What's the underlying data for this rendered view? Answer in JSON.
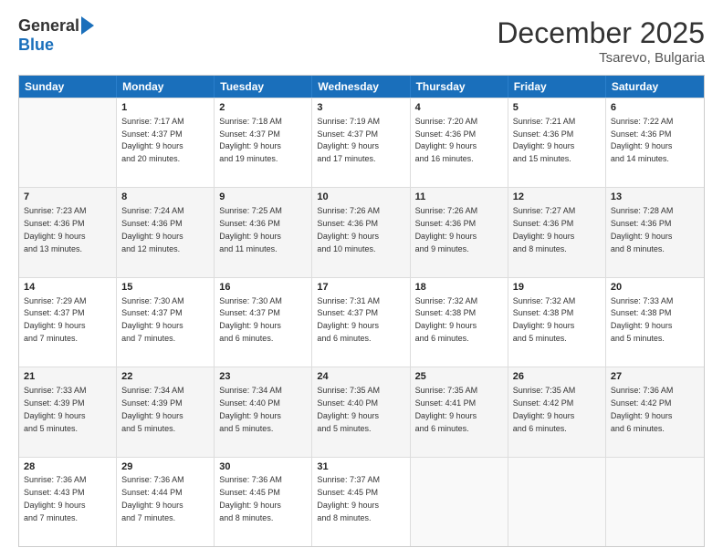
{
  "logo": {
    "general": "General",
    "blue": "Blue"
  },
  "title": "December 2025",
  "location": "Tsarevo, Bulgaria",
  "days": [
    "Sunday",
    "Monday",
    "Tuesday",
    "Wednesday",
    "Thursday",
    "Friday",
    "Saturday"
  ],
  "weeks": [
    [
      {
        "day": "",
        "info": ""
      },
      {
        "day": "1",
        "info": "Sunrise: 7:17 AM\nSunset: 4:37 PM\nDaylight: 9 hours\nand 20 minutes."
      },
      {
        "day": "2",
        "info": "Sunrise: 7:18 AM\nSunset: 4:37 PM\nDaylight: 9 hours\nand 19 minutes."
      },
      {
        "day": "3",
        "info": "Sunrise: 7:19 AM\nSunset: 4:37 PM\nDaylight: 9 hours\nand 17 minutes."
      },
      {
        "day": "4",
        "info": "Sunrise: 7:20 AM\nSunset: 4:36 PM\nDaylight: 9 hours\nand 16 minutes."
      },
      {
        "day": "5",
        "info": "Sunrise: 7:21 AM\nSunset: 4:36 PM\nDaylight: 9 hours\nand 15 minutes."
      },
      {
        "day": "6",
        "info": "Sunrise: 7:22 AM\nSunset: 4:36 PM\nDaylight: 9 hours\nand 14 minutes."
      }
    ],
    [
      {
        "day": "7",
        "info": "Sunrise: 7:23 AM\nSunset: 4:36 PM\nDaylight: 9 hours\nand 13 minutes."
      },
      {
        "day": "8",
        "info": "Sunrise: 7:24 AM\nSunset: 4:36 PM\nDaylight: 9 hours\nand 12 minutes."
      },
      {
        "day": "9",
        "info": "Sunrise: 7:25 AM\nSunset: 4:36 PM\nDaylight: 9 hours\nand 11 minutes."
      },
      {
        "day": "10",
        "info": "Sunrise: 7:26 AM\nSunset: 4:36 PM\nDaylight: 9 hours\nand 10 minutes."
      },
      {
        "day": "11",
        "info": "Sunrise: 7:26 AM\nSunset: 4:36 PM\nDaylight: 9 hours\nand 9 minutes."
      },
      {
        "day": "12",
        "info": "Sunrise: 7:27 AM\nSunset: 4:36 PM\nDaylight: 9 hours\nand 8 minutes."
      },
      {
        "day": "13",
        "info": "Sunrise: 7:28 AM\nSunset: 4:36 PM\nDaylight: 9 hours\nand 8 minutes."
      }
    ],
    [
      {
        "day": "14",
        "info": "Sunrise: 7:29 AM\nSunset: 4:37 PM\nDaylight: 9 hours\nand 7 minutes."
      },
      {
        "day": "15",
        "info": "Sunrise: 7:30 AM\nSunset: 4:37 PM\nDaylight: 9 hours\nand 7 minutes."
      },
      {
        "day": "16",
        "info": "Sunrise: 7:30 AM\nSunset: 4:37 PM\nDaylight: 9 hours\nand 6 minutes."
      },
      {
        "day": "17",
        "info": "Sunrise: 7:31 AM\nSunset: 4:37 PM\nDaylight: 9 hours\nand 6 minutes."
      },
      {
        "day": "18",
        "info": "Sunrise: 7:32 AM\nSunset: 4:38 PM\nDaylight: 9 hours\nand 6 minutes."
      },
      {
        "day": "19",
        "info": "Sunrise: 7:32 AM\nSunset: 4:38 PM\nDaylight: 9 hours\nand 5 minutes."
      },
      {
        "day": "20",
        "info": "Sunrise: 7:33 AM\nSunset: 4:38 PM\nDaylight: 9 hours\nand 5 minutes."
      }
    ],
    [
      {
        "day": "21",
        "info": "Sunrise: 7:33 AM\nSunset: 4:39 PM\nDaylight: 9 hours\nand 5 minutes."
      },
      {
        "day": "22",
        "info": "Sunrise: 7:34 AM\nSunset: 4:39 PM\nDaylight: 9 hours\nand 5 minutes."
      },
      {
        "day": "23",
        "info": "Sunrise: 7:34 AM\nSunset: 4:40 PM\nDaylight: 9 hours\nand 5 minutes."
      },
      {
        "day": "24",
        "info": "Sunrise: 7:35 AM\nSunset: 4:40 PM\nDaylight: 9 hours\nand 5 minutes."
      },
      {
        "day": "25",
        "info": "Sunrise: 7:35 AM\nSunset: 4:41 PM\nDaylight: 9 hours\nand 6 minutes."
      },
      {
        "day": "26",
        "info": "Sunrise: 7:35 AM\nSunset: 4:42 PM\nDaylight: 9 hours\nand 6 minutes."
      },
      {
        "day": "27",
        "info": "Sunrise: 7:36 AM\nSunset: 4:42 PM\nDaylight: 9 hours\nand 6 minutes."
      }
    ],
    [
      {
        "day": "28",
        "info": "Sunrise: 7:36 AM\nSunset: 4:43 PM\nDaylight: 9 hours\nand 7 minutes."
      },
      {
        "day": "29",
        "info": "Sunrise: 7:36 AM\nSunset: 4:44 PM\nDaylight: 9 hours\nand 7 minutes."
      },
      {
        "day": "30",
        "info": "Sunrise: 7:36 AM\nSunset: 4:45 PM\nDaylight: 9 hours\nand 8 minutes."
      },
      {
        "day": "31",
        "info": "Sunrise: 7:37 AM\nSunset: 4:45 PM\nDaylight: 9 hours\nand 8 minutes."
      },
      {
        "day": "",
        "info": ""
      },
      {
        "day": "",
        "info": ""
      },
      {
        "day": "",
        "info": ""
      }
    ]
  ]
}
